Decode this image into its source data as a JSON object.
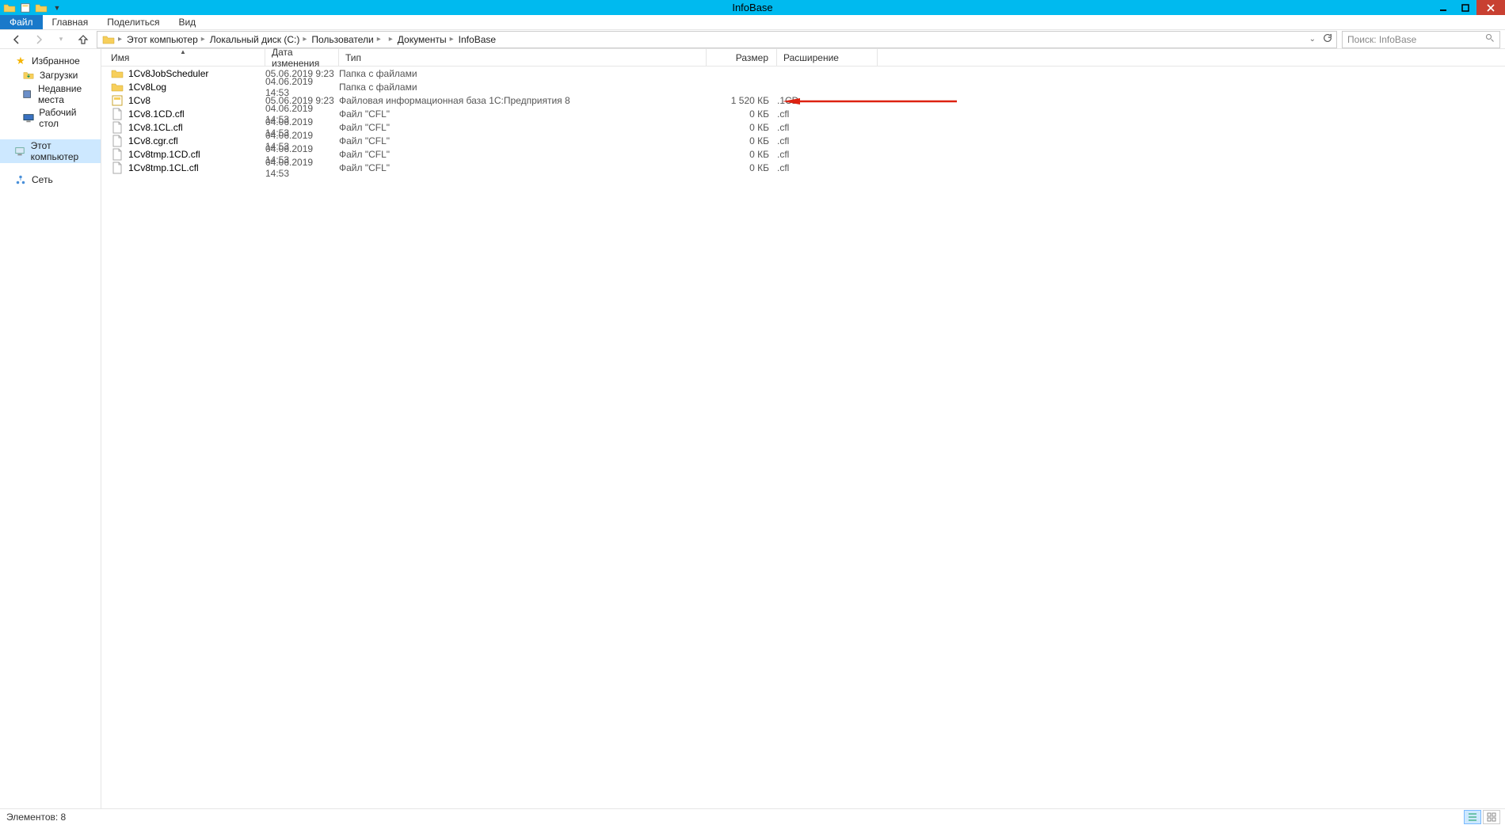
{
  "titlebar": {
    "title": "InfoBase"
  },
  "ribbon": {
    "file": "Файл",
    "tabs": [
      "Главная",
      "Поделиться",
      "Вид"
    ]
  },
  "breadcrumb": {
    "items": [
      "Этот компьютер",
      "Локальный диск (C:)",
      "Пользователи",
      "",
      "Документы",
      "InfoBase"
    ]
  },
  "search": {
    "placeholder": "Поиск: InfoBase"
  },
  "navpane": {
    "favorites": {
      "label": "Избранное",
      "items": [
        "Загрузки",
        "Недавние места",
        "Рабочий стол"
      ]
    },
    "computer": "Этот компьютер",
    "network": "Сеть"
  },
  "columns": {
    "name": "Имя",
    "date": "Дата изменения",
    "type": "Тип",
    "size": "Размер",
    "ext": "Расширение"
  },
  "files": [
    {
      "icon": "folder",
      "name": "1Cv8JobScheduler",
      "date": "05.06.2019 9:23",
      "type": "Папка с файлами",
      "size": "",
      "ext": ""
    },
    {
      "icon": "folder",
      "name": "1Cv8Log",
      "date": "04.06.2019 14:53",
      "type": "Папка с файлами",
      "size": "",
      "ext": ""
    },
    {
      "icon": "db",
      "name": "1Cv8",
      "date": "05.06.2019 9:23",
      "type": "Файловая информационная база 1С:Предприятия 8",
      "size": "1 520 КБ",
      "ext": ".1CD"
    },
    {
      "icon": "file",
      "name": "1Cv8.1CD.cfl",
      "date": "04.06.2019 14:53",
      "type": "Файл \"CFL\"",
      "size": "0 КБ",
      "ext": ".cfl"
    },
    {
      "icon": "file",
      "name": "1Cv8.1CL.cfl",
      "date": "04.06.2019 14:53",
      "type": "Файл \"CFL\"",
      "size": "0 КБ",
      "ext": ".cfl"
    },
    {
      "icon": "file",
      "name": "1Cv8.cgr.cfl",
      "date": "04.06.2019 14:53",
      "type": "Файл \"CFL\"",
      "size": "0 КБ",
      "ext": ".cfl"
    },
    {
      "icon": "file",
      "name": "1Cv8tmp.1CD.cfl",
      "date": "04.06.2019 14:53",
      "type": "Файл \"CFL\"",
      "size": "0 КБ",
      "ext": ".cfl"
    },
    {
      "icon": "file",
      "name": "1Cv8tmp.1CL.cfl",
      "date": "04.06.2019 14:53",
      "type": "Файл \"CFL\"",
      "size": "0 КБ",
      "ext": ".cfl"
    }
  ],
  "status": {
    "text": "Элементов: 8"
  }
}
